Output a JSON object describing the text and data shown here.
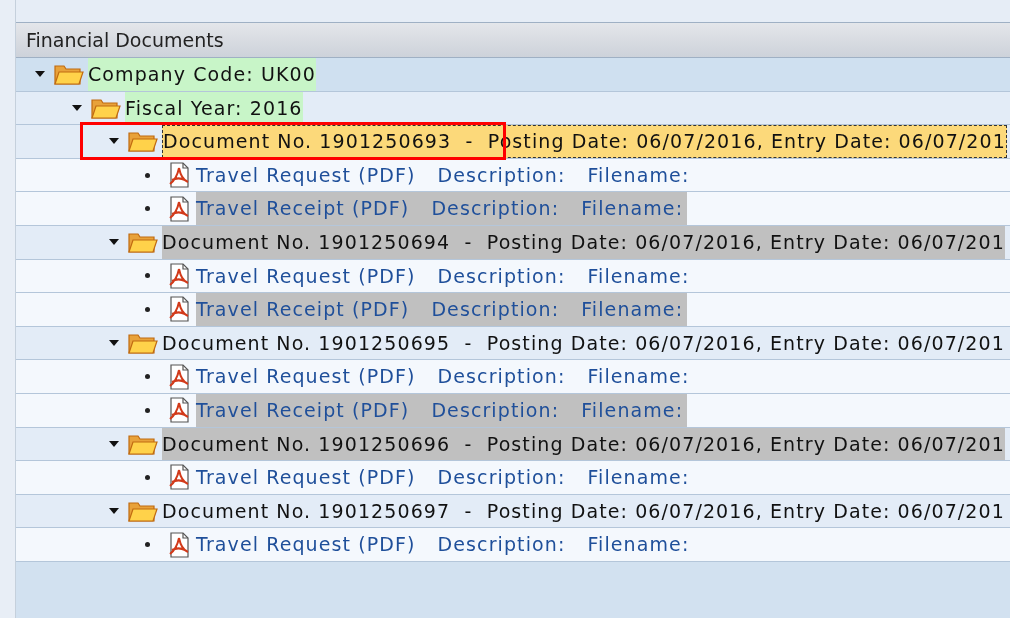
{
  "panel": {
    "title": "Financial Documents"
  },
  "tree": [
    {
      "kind": "folder",
      "label": "Company Code: UK00",
      "expanded": true,
      "color": "#c8f5c8",
      "selected": false,
      "annotated": false,
      "children": [
        {
          "kind": "folder",
          "label": "Fiscal Year: 2016",
          "expanded": true,
          "color": "#c8f5c8",
          "selected": false,
          "annotated": false,
          "children": [
            {
              "kind": "folder",
              "label": "Document No. 1901250693  -  Posting Date: 06/07/2016, Entry Date: 06/07/201",
              "expanded": true,
              "selected": true,
              "annotated": true,
              "children": [
                {
                  "kind": "file",
                  "label": "Travel Request (PDF)",
                  "description": "Description:",
                  "filename": "Filename:"
                },
                {
                  "kind": "file",
                  "label": "Travel Receipt (PDF)",
                  "description": "Description:",
                  "filename": "Filename:",
                  "color": "#c0c0c0"
                }
              ]
            },
            {
              "kind": "folder",
              "label": "Document No. 1901250694  -  Posting Date: 06/07/2016, Entry Date: 06/07/201",
              "expanded": true,
              "color": "#c0c0c0",
              "selected": false,
              "annotated": false,
              "children": [
                {
                  "kind": "file",
                  "label": "Travel Request (PDF)",
                  "description": "Description:",
                  "filename": "Filename:"
                },
                {
                  "kind": "file",
                  "label": "Travel Receipt (PDF)",
                  "description": "Description:",
                  "filename": "Filename:",
                  "color": "#c0c0c0"
                }
              ]
            },
            {
              "kind": "folder",
              "label": "Document No. 1901250695  -  Posting Date: 06/07/2016, Entry Date: 06/07/201",
              "expanded": true,
              "selected": false,
              "annotated": false,
              "children": [
                {
                  "kind": "file",
                  "label": "Travel Request (PDF)",
                  "description": "Description:",
                  "filename": "Filename:"
                },
                {
                  "kind": "file",
                  "label": "Travel Receipt (PDF)",
                  "description": "Description:",
                  "filename": "Filename:",
                  "color": "#c0c0c0"
                }
              ]
            },
            {
              "kind": "folder",
              "label": "Document No. 1901250696  -  Posting Date: 06/07/2016, Entry Date: 06/07/201",
              "expanded": true,
              "color": "#c0c0c0",
              "selected": false,
              "annotated": false,
              "children": [
                {
                  "kind": "file",
                  "label": "Travel Request (PDF)",
                  "description": "Description:",
                  "filename": "Filename:"
                }
              ]
            },
            {
              "kind": "folder",
              "label": "Document No. 1901250697  -  Posting Date: 06/07/2016, Entry Date: 06/07/201",
              "expanded": true,
              "selected": false,
              "annotated": false,
              "children": [
                {
                  "kind": "file",
                  "label": "Travel Request (PDF)",
                  "description": "Description:",
                  "filename": "Filename:"
                }
              ]
            }
          ]
        }
      ]
    }
  ]
}
